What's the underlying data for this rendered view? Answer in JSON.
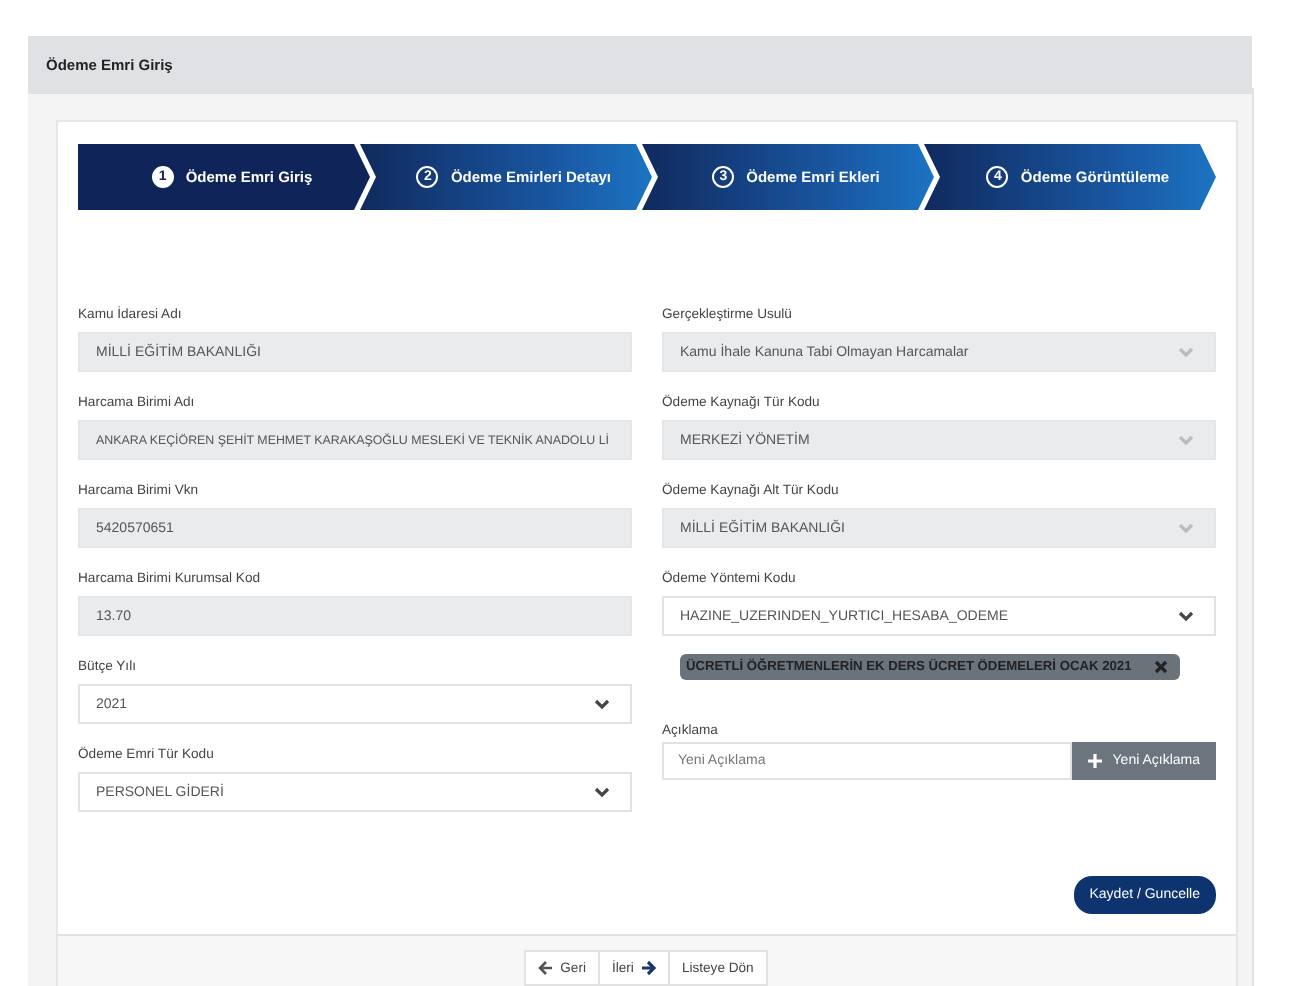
{
  "page_title": "Ödeme Emri Giriş",
  "steps": [
    {
      "number": "1",
      "label": "Ödeme Emri Giriş",
      "selected": true
    },
    {
      "number": "2",
      "label": "Ödeme Emirleri Detayı",
      "selected": false
    },
    {
      "number": "3",
      "label": "Ödeme Emri Ekleri",
      "selected": false
    },
    {
      "number": "4",
      "label": "Ödeme Görüntüleme",
      "selected": false
    }
  ],
  "left_fields": [
    {
      "label": "Kamu İdaresi Adı",
      "kind": "text",
      "value": "MİLLİ EĞİTİM BAKANLIĞI",
      "disabled": true
    },
    {
      "label": "Harcama Birimi Adı",
      "kind": "text",
      "value": "ANKARA KEÇİÖREN ŞEHİT MEHMET KARAKAŞOĞLU MESLEKİ VE TEKNİK ANADOLU Lİ",
      "disabled": true
    },
    {
      "label": "Harcama Birimi Vkn",
      "kind": "text",
      "value": "5420570651",
      "disabled": true
    },
    {
      "label": "Harcama Birimi Kurumsal Kod",
      "kind": "text",
      "value": "13.70",
      "disabled": true
    },
    {
      "label": "Bütçe Yılı",
      "kind": "select",
      "value": "2021",
      "disabled": false
    },
    {
      "label": "Ödeme Emri Tür Kodu",
      "kind": "select",
      "value": "PERSONEL GİDERİ",
      "disabled": false
    }
  ],
  "right_fields": [
    {
      "label": "Gerçekleştirme Usulü",
      "kind": "select",
      "value": "Kamu İhale Kanuna Tabi Olmayan Harcamalar",
      "disabled": true
    },
    {
      "label": "Ödeme Kaynağı Tür Kodu",
      "kind": "select",
      "value": "MERKEZİ YÖNETİM",
      "disabled": true
    },
    {
      "label": "Ödeme Kaynağı Alt Tür Kodu",
      "kind": "select",
      "value": "MİLLİ EĞİTİM BAKANLIĞI",
      "disabled": true
    },
    {
      "label": "Ödeme Yöntemi Kodu",
      "kind": "select",
      "value": "HAZINE_UZERINDEN_YURTICI_HESABA_ODEME",
      "disabled": false
    }
  ],
  "tags": [
    {
      "label": "ÜCRETLİ ÖĞRETMENLERİN EK DERS ÜCRET ÖDEMELERİ OCAK 2021"
    }
  ],
  "note": {
    "label": "Açıklama",
    "placeholder": "Yeni Açıklama",
    "button": "Yeni Açıklama"
  },
  "save_button": "Kaydet / Guncelle",
  "nav_buttons": [
    {
      "label": "Geri",
      "kind": "back"
    },
    {
      "label": "İleri",
      "kind": "next"
    },
    {
      "label": "Listeye Dön",
      "kind": "plain"
    }
  ]
}
